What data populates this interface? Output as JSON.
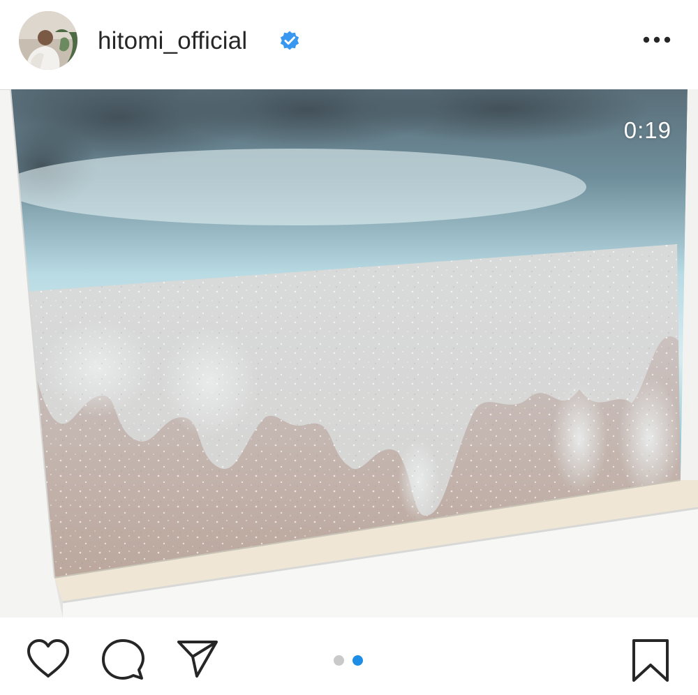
{
  "post": {
    "username": "hitomi_official",
    "verified": true,
    "video_duration": "0:19",
    "carousel": {
      "total": 2,
      "current": 2
    }
  },
  "icons": {
    "avatar": "profile-avatar",
    "verified": "verified-badge-icon",
    "more": "more-options-icon",
    "like": "heart-icon",
    "comment": "comment-icon",
    "share": "share-paper-plane-icon",
    "save": "bookmark-icon"
  },
  "colors": {
    "accent_blue": "#1e8de6",
    "inactive_dot": "#c9c9c9",
    "text": "#262626"
  }
}
